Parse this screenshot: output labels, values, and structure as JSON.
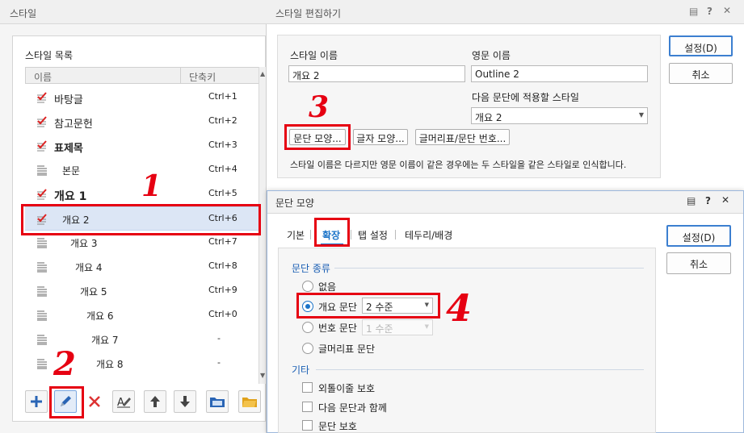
{
  "style_window": {
    "title": "스타일",
    "list_title": "스타일 목록",
    "col_name": "이름",
    "col_shortcut": "단축키",
    "items": [
      {
        "name": "바탕글",
        "shortcut": "Ctrl+1",
        "icon": "checked-doc-icon"
      },
      {
        "name": "참고문헌",
        "shortcut": "Ctrl+2",
        "icon": "checked-doc-icon"
      },
      {
        "name": "표제목",
        "shortcut": "Ctrl+3",
        "icon": "checked-doc-icon"
      },
      {
        "name": "본문",
        "shortcut": "Ctrl+4",
        "icon": "paragraph-icon"
      },
      {
        "name": "개요 1",
        "shortcut": "Ctrl+5",
        "icon": "checked-doc-icon"
      },
      {
        "name": "개요 2",
        "shortcut": "Ctrl+6",
        "icon": "checked-doc-icon",
        "selected": true
      },
      {
        "name": "개요 3",
        "shortcut": "Ctrl+7",
        "icon": "paragraph-icon"
      },
      {
        "name": "개요 4",
        "shortcut": "Ctrl+8",
        "icon": "paragraph-icon"
      },
      {
        "name": "개요 5",
        "shortcut": "Ctrl+9",
        "icon": "paragraph-icon"
      },
      {
        "name": "개요 6",
        "shortcut": "Ctrl+0",
        "icon": "paragraph-icon"
      },
      {
        "name": "개요 7",
        "shortcut": "-",
        "icon": "paragraph-icon"
      },
      {
        "name": "개요 8",
        "shortcut": "-",
        "icon": "paragraph-icon"
      }
    ]
  },
  "edit_dialog": {
    "title": "스타일 편집하기",
    "style_name_label": "스타일 이름",
    "style_name_value": "개요 2",
    "english_name_label": "영문 이름",
    "english_name_value": "Outline 2",
    "next_style_label": "다음 문단에 적용할 스타일",
    "next_style_value": "개요 2",
    "btn_paragraph": "문단 모양...",
    "btn_char": "글자 모양...",
    "btn_bullet": "글머리표/문단 번호...",
    "note": "스타일 이름은 다르지만 영문 이름이 같은 경우에는 두 스타일을 같은 스타일로 인식합니다.",
    "ok": "설정(D)",
    "cancel": "취소"
  },
  "para_dialog": {
    "title": "문단 모양",
    "tabs": [
      "기본",
      "확장",
      "탭 설정",
      "테두리/배경"
    ],
    "active_tab": "확장",
    "section_type": "문단 종류",
    "opt_none": "없음",
    "opt_outline": "개요 문단",
    "outline_level": "2 수준",
    "opt_number": "번호 문단",
    "number_level": "1 수준",
    "opt_bullet": "글머리표 문단",
    "section_other": "기타",
    "chk_widow": "외톨이줄 보호",
    "chk_keep_next": "다음 문단과 함께",
    "chk_protect": "문단 보호",
    "ok": "설정(D)",
    "cancel": "취소"
  },
  "annotations": [
    "1",
    "2",
    "3",
    "4"
  ],
  "colors": {
    "annotation_red": "#e60012",
    "accent_blue": "#1a73c8",
    "selection": "#dce6f5"
  }
}
